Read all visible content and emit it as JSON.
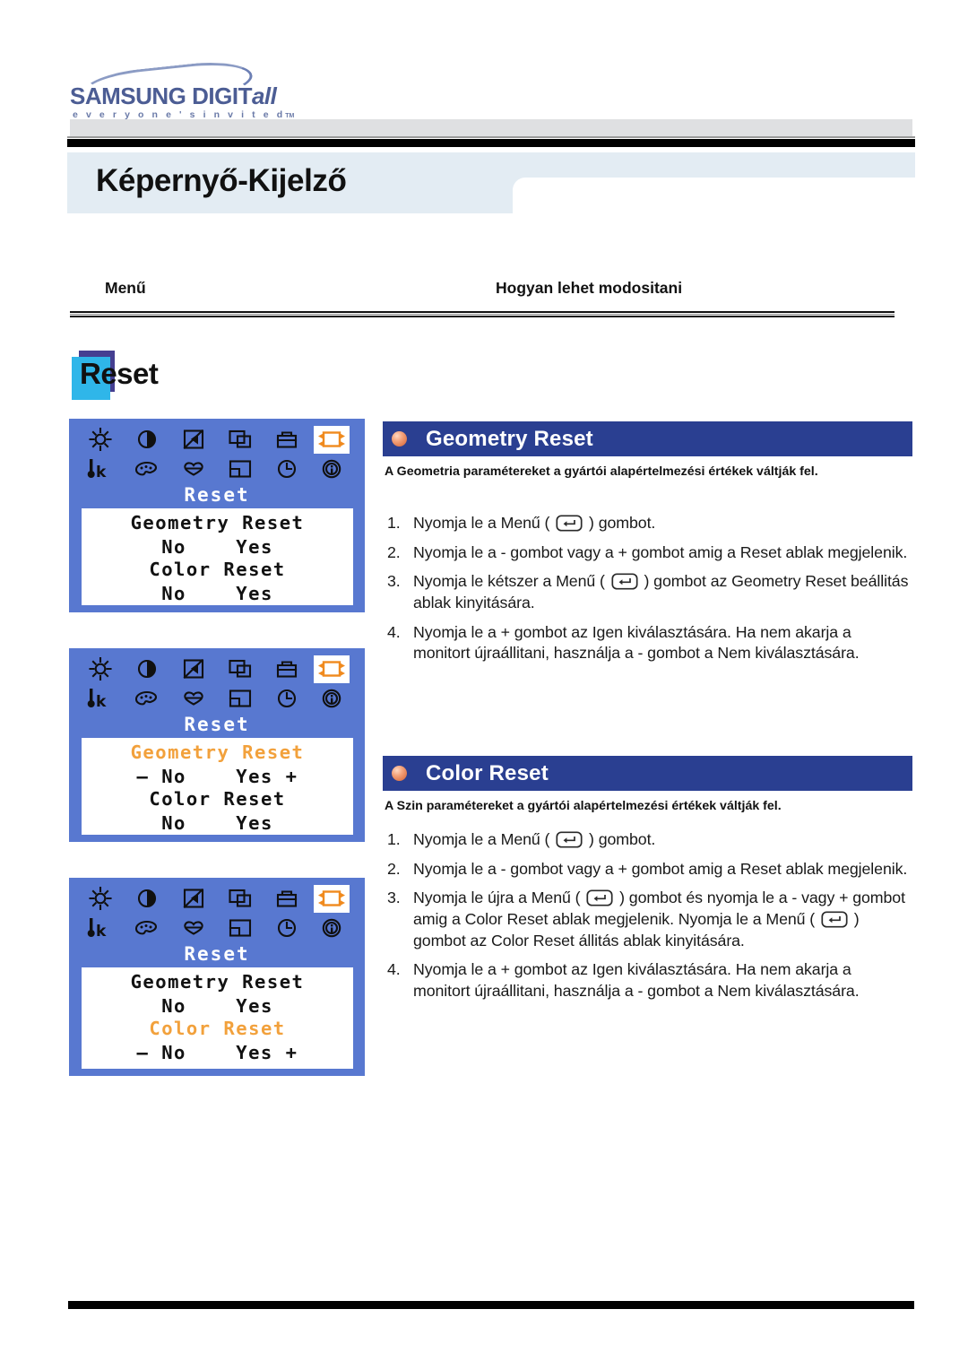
{
  "logo": {
    "brand": "SAMSUNG DIGIT",
    "brand_italic": "all",
    "tagline": "e v e r y o n e ' s   i n v i t e d",
    "tagline_tm": "TM"
  },
  "page_title": "Képernyő-Kijelző",
  "columns": {
    "menu_header": "Menű",
    "how_header": "Hogyan lehet modositani"
  },
  "section_label": "Reset",
  "osd_panels": [
    {
      "title": "Reset",
      "selected_icon": "reset-icon",
      "lines": [
        {
          "text": "Geometry Reset",
          "highlight": false
        },
        {
          "text": "No    Yes",
          "highlight": false
        },
        {
          "text": "Color Reset",
          "highlight": false
        },
        {
          "text": "No    Yes",
          "highlight": false
        }
      ]
    },
    {
      "title": "Reset",
      "selected_icon": "reset-icon",
      "lines": [
        {
          "text": "Geometry Reset",
          "highlight": true
        },
        {
          "text": "– No    Yes +",
          "highlight": false
        },
        {
          "text": "Color Reset",
          "highlight": false
        },
        {
          "text": "No    Yes",
          "highlight": false
        }
      ]
    },
    {
      "title": "Reset",
      "selected_icon": "reset-icon",
      "lines": [
        {
          "text": "Geometry Reset",
          "highlight": false
        },
        {
          "text": "No    Yes",
          "highlight": false
        },
        {
          "text": "Color Reset",
          "highlight": true
        },
        {
          "text": "– No    Yes +",
          "highlight": false
        }
      ]
    }
  ],
  "osd_icon_names": [
    "brightness-icon",
    "contrast-icon",
    "sharpness-icon",
    "h-position-icon",
    "image-lock-icon",
    "reset-icon",
    "color-temperature-icon",
    "color-palette-icon",
    "color-tone-icon",
    "osd-position-icon",
    "osd-timer-icon",
    "information-icon"
  ],
  "sections": [
    {
      "heading": "Geometry Reset",
      "description": "A Geometria paramétereket a gyártói alapértelmezési értékek váltják fel.",
      "steps": [
        {
          "num": "1.",
          "before": "Nyomja le a Menű  ( ",
          "after": " ) gombot.",
          "has_key": true
        },
        {
          "num": "2.",
          "before": "Nyomja le a - gombot vagy a + gombot amig a Reset ablak megjelenik.",
          "after": "",
          "has_key": false
        },
        {
          "num": "3.",
          "before": "Nyomja le kétszer a Menű ( ",
          "after": " ) gombot az Geometry Reset beállitás ablak kinyitására.",
          "has_key": true
        },
        {
          "num": "4.",
          "before": "Nyomja le a + gombot az Igen kiválasztására. Ha nem akarja a monitort újraállitani, használja a - gombot a Nem kiválasztására.",
          "after": "",
          "has_key": false
        }
      ]
    },
    {
      "heading": "Color Reset",
      "description": "A Szin paramétereket a gyártói alapértelmezési értékek váltják fel.",
      "steps": [
        {
          "num": "1.",
          "before": "Nyomja le a Menű  ( ",
          "after": " ) gombot.",
          "has_key": true
        },
        {
          "num": "2.",
          "before": "Nyomja le a - gombot vagy a + gombot amig a Reset ablak megjelenik.",
          "after": "",
          "has_key": false
        },
        {
          "num": "3.",
          "before": "Nyomja le újra a Menű ( ",
          "mid": " ) gombot és nyomja le a - vagy + gombot amig a Color Reset ablak megjelenik. Nyomja le a Menű ( ",
          "after": " ) gombot az Color Reset állitás ablak kinyitására.",
          "has_key": true,
          "has_key2": true
        },
        {
          "num": "4.",
          "before": "Nyomja le a + gombot az Igen kiválasztására. Ha nem akarja a monitort újraállitani, használja a - gombot a Nem kiválasztására.",
          "after": "",
          "has_key": false
        }
      ]
    }
  ],
  "colors": {
    "osd_background": "#5878d0",
    "osd_highlight_text": "#f2a13c",
    "section_bar": "#2a3f91",
    "title_band": "#e3ecf3",
    "label_front": "#2fb6e9",
    "label_back": "#453f91"
  }
}
